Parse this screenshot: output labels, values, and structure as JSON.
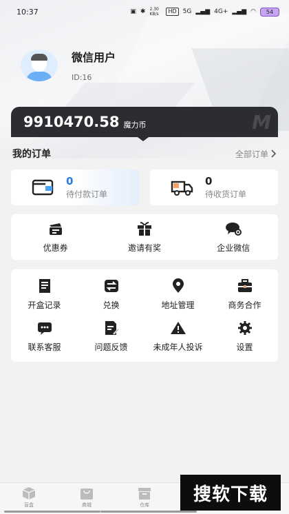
{
  "status_bar": {
    "time": "10:37",
    "network_speed": "2.30 KB/s",
    "hd_label": "HD",
    "signal_5g": "5G",
    "signal_4g": "4G+",
    "battery": "54"
  },
  "profile": {
    "name": "微信用户",
    "id": "ID:16"
  },
  "balance": {
    "value": "9910470.58",
    "unit": "魔力币",
    "logo": "M"
  },
  "orders": {
    "title": "我的订单",
    "all_label": "全部订单",
    "pending_payment": {
      "count": "0",
      "label": "待付款订单"
    },
    "pending_receipt": {
      "count": "0",
      "label": "待收货订单"
    }
  },
  "quick_menu": [
    {
      "label": "优惠券",
      "icon": "coupon-icon"
    },
    {
      "label": "邀请有奖",
      "icon": "gift-icon"
    },
    {
      "label": "企业微信",
      "icon": "wecom-icon"
    }
  ],
  "grid_menu": [
    {
      "label": "开盒记录",
      "icon": "receipt-icon"
    },
    {
      "label": "兑换",
      "icon": "exchange-icon"
    },
    {
      "label": "地址管理",
      "icon": "location-icon"
    },
    {
      "label": "商务合作",
      "icon": "briefcase-icon"
    },
    {
      "label": "联系客服",
      "icon": "chat-icon"
    },
    {
      "label": "问题反馈",
      "icon": "feedback-icon"
    },
    {
      "label": "未成年人投诉",
      "icon": "warning-icon"
    },
    {
      "label": "设置",
      "icon": "gear-icon"
    }
  ],
  "tabbar": [
    {
      "label": "盲盒",
      "icon": "box-icon"
    },
    {
      "label": "商城",
      "icon": "shop-icon"
    },
    {
      "label": "仓库",
      "icon": "warehouse-icon"
    }
  ],
  "watermark": "搜软下载",
  "colors": {
    "accent_blue": "#2a7ae2",
    "card_dark": "#2c2d31",
    "battery": "#c6a6f0"
  }
}
